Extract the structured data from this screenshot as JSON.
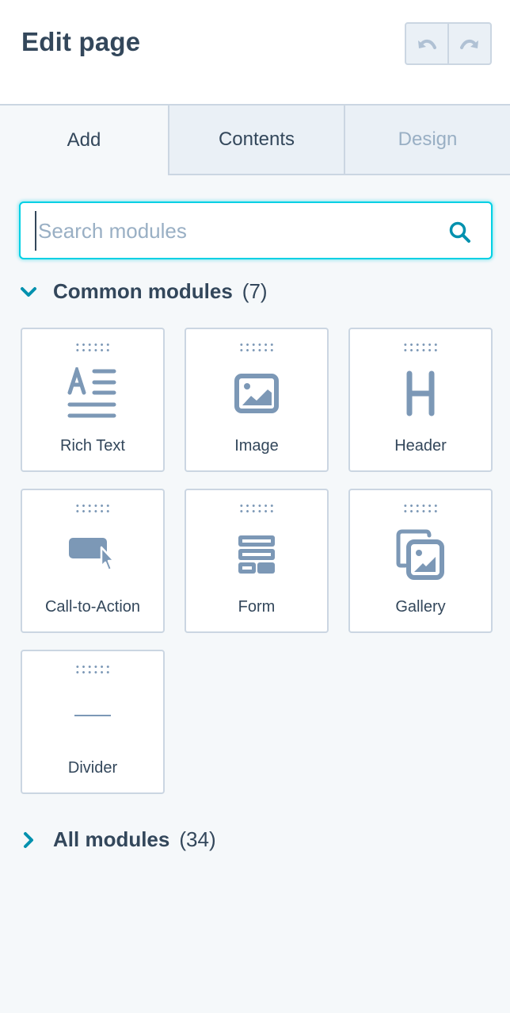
{
  "header": {
    "title": "Edit page",
    "undo_icon": "undo-icon",
    "redo_icon": "redo-icon"
  },
  "tabs": [
    {
      "label": "Add",
      "state": "active"
    },
    {
      "label": "Contents",
      "state": "inactive"
    },
    {
      "label": "Design",
      "state": "disabled"
    }
  ],
  "search": {
    "value": "",
    "placeholder": "Search modules",
    "icon": "search-icon"
  },
  "common_modules": {
    "label": "Common modules",
    "count": "(7)",
    "expanded": true,
    "items": [
      {
        "label": "Rich Text",
        "icon": "rich-text-icon"
      },
      {
        "label": "Image",
        "icon": "image-icon"
      },
      {
        "label": "Header",
        "icon": "header-icon"
      },
      {
        "label": "Call-to-Action",
        "icon": "cta-icon"
      },
      {
        "label": "Form",
        "icon": "form-icon"
      },
      {
        "label": "Gallery",
        "icon": "gallery-icon"
      },
      {
        "label": "Divider",
        "icon": "divider-icon"
      }
    ]
  },
  "all_modules": {
    "label": "All modules",
    "count": "(34)",
    "expanded": false
  },
  "colors": {
    "accent": "#0091ae",
    "focus": "#00d0e4",
    "text": "#33475b",
    "icon": "#7c98b6",
    "border": "#cbd6e2"
  }
}
